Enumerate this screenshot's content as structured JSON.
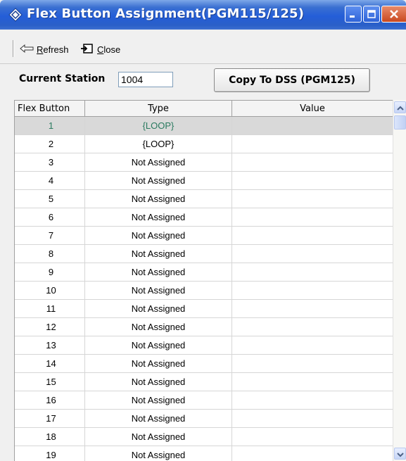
{
  "window": {
    "title": "Flex Button Assignment(PGM115/125)"
  },
  "toolbar": {
    "refresh_label": "Refresh",
    "close_label": "Close"
  },
  "station": {
    "label": "Current Station",
    "value": "1004",
    "copy_button": "Copy To DSS (PGM125)"
  },
  "grid": {
    "headers": [
      "Flex Button",
      "Type",
      "Value"
    ],
    "selected_row": 0,
    "rows": [
      {
        "button": "1",
        "type": "{LOOP}",
        "value": ""
      },
      {
        "button": "2",
        "type": "{LOOP}",
        "value": ""
      },
      {
        "button": "3",
        "type": "Not Assigned",
        "value": ""
      },
      {
        "button": "4",
        "type": "Not Assigned",
        "value": ""
      },
      {
        "button": "5",
        "type": "Not Assigned",
        "value": ""
      },
      {
        "button": "6",
        "type": "Not Assigned",
        "value": ""
      },
      {
        "button": "7",
        "type": "Not Assigned",
        "value": ""
      },
      {
        "button": "8",
        "type": "Not Assigned",
        "value": ""
      },
      {
        "button": "9",
        "type": "Not Assigned",
        "value": ""
      },
      {
        "button": "10",
        "type": "Not Assigned",
        "value": ""
      },
      {
        "button": "11",
        "type": "Not Assigned",
        "value": ""
      },
      {
        "button": "12",
        "type": "Not Assigned",
        "value": ""
      },
      {
        "button": "13",
        "type": "Not Assigned",
        "value": ""
      },
      {
        "button": "14",
        "type": "Not Assigned",
        "value": ""
      },
      {
        "button": "15",
        "type": "Not Assigned",
        "value": ""
      },
      {
        "button": "16",
        "type": "Not Assigned",
        "value": ""
      },
      {
        "button": "17",
        "type": "Not Assigned",
        "value": ""
      },
      {
        "button": "18",
        "type": "Not Assigned",
        "value": ""
      },
      {
        "button": "19",
        "type": "Not Assigned",
        "value": ""
      }
    ]
  },
  "colors": {
    "titlebar": "#245ed8",
    "selected_row_bg": "#d9d9d9",
    "selected_row_text": "#2a7a5f"
  },
  "icons": {
    "title": "diamond-app-icon",
    "refresh": "arrow-left-icon",
    "close": "close-window-icon",
    "minimize": "minimize-icon",
    "maximize": "maximize-icon",
    "window_close": "x-close-icon",
    "scroll_up": "chevron-up-icon",
    "scroll_down": "chevron-down-icon"
  }
}
